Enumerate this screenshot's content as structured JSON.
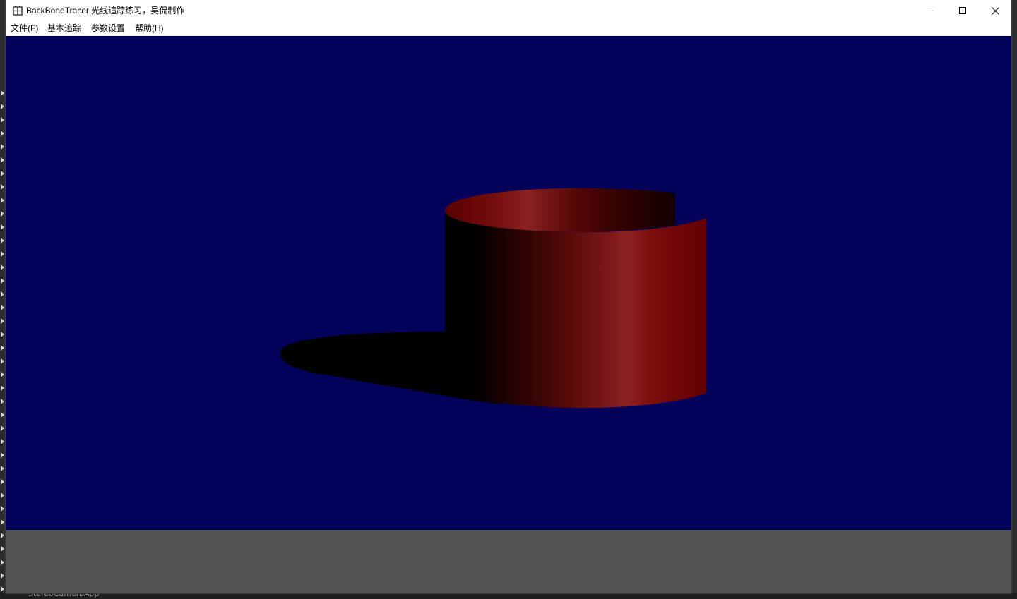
{
  "window": {
    "title": "BackBoneTracer 光线追踪练习，吴侃制作"
  },
  "menu": {
    "items": [
      {
        "label": "文件(F)"
      },
      {
        "label": "基本追踪"
      },
      {
        "label": "参数设置"
      },
      {
        "label": "帮助(H)"
      }
    ]
  },
  "render": {
    "background_color": "#02025a",
    "object_color": "#8b2222",
    "shadow_color": "#000000"
  },
  "colors": {
    "title_bar": "#ffffff",
    "status_panel": "#545454"
  },
  "background_app": {
    "status_text": "StereoCameraApp"
  }
}
